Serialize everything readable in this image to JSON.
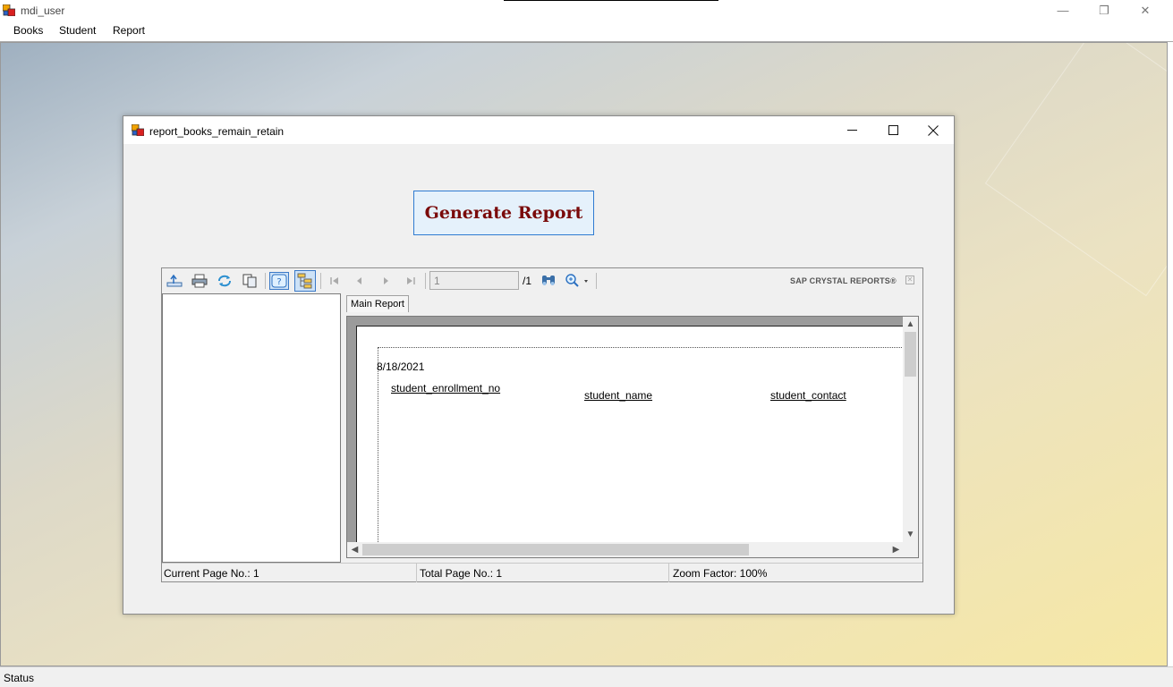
{
  "app": {
    "title": "mdi_user",
    "menu": [
      "Books",
      "Student",
      "Report"
    ],
    "status": "Status"
  },
  "child": {
    "title": "report_books_remain_retain",
    "generate_button": "Generate Report"
  },
  "viewer": {
    "brand": "SAP CRYSTAL REPORTS®",
    "page_input": "1",
    "page_total": "/1",
    "tab": "Main Report",
    "report": {
      "date": "8/18/2021",
      "columns": [
        "student_enrollment_no",
        "student_name",
        "student_contact"
      ]
    },
    "status": {
      "current_page": "Current Page No.: 1",
      "total_page": "Total Page No.: 1",
      "zoom": "Zoom Factor: 100%"
    }
  },
  "colors": {
    "button_text": "#7a0a0a",
    "button_border": "#2f7bd1",
    "button_bg": "#e5f1fb"
  },
  "icons": [
    "app-icon",
    "minimize-icon",
    "restore-icon",
    "maximize-icon",
    "close-icon",
    "export-icon",
    "print-icon",
    "refresh-icon",
    "copy-icon",
    "help-icon",
    "group-tree-icon",
    "first-page-icon",
    "prev-page-icon",
    "next-page-icon",
    "last-page-icon",
    "find-icon",
    "zoom-icon"
  ]
}
